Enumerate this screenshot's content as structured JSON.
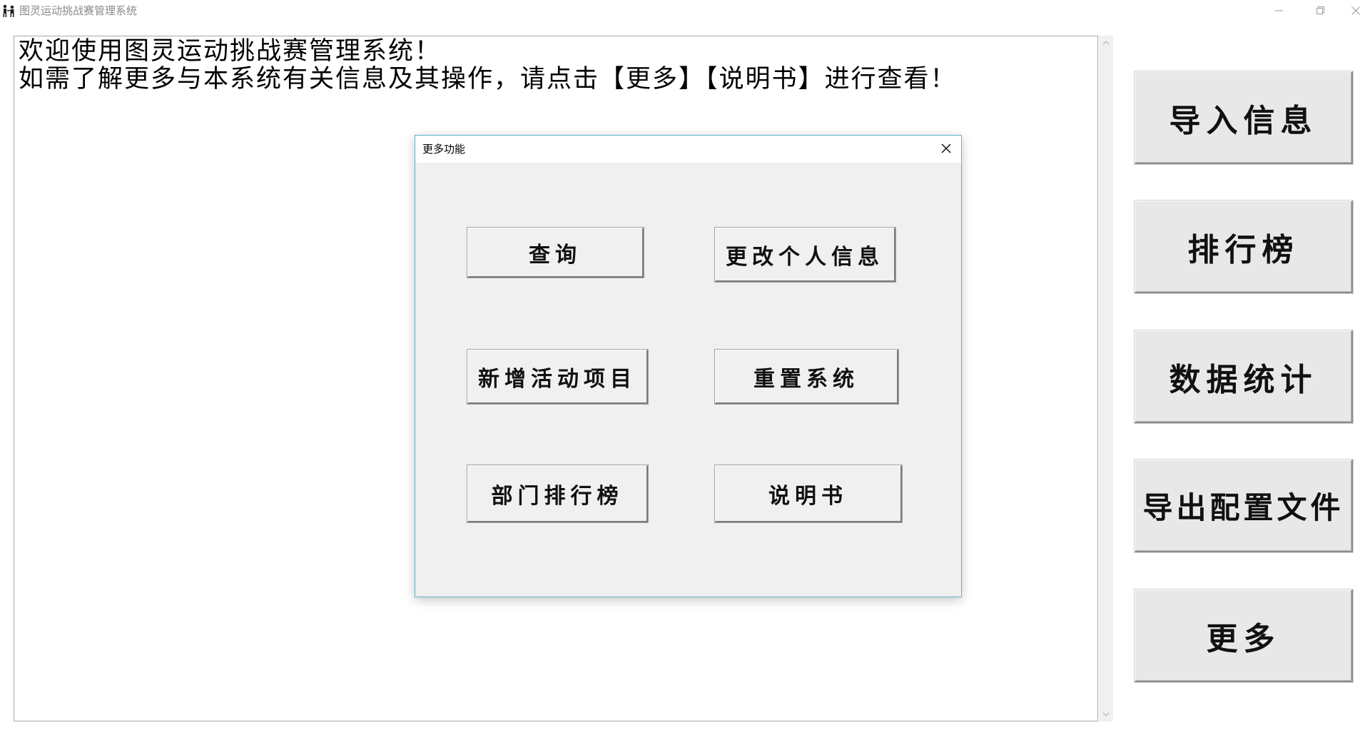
{
  "window": {
    "title": "图灵运动挑战赛管理系统",
    "icon": "people-app-icon",
    "controls": [
      "minimize-icon",
      "restore-icon",
      "close-icon"
    ]
  },
  "main": {
    "welcome_line1": "欢迎使用图灵运动挑战赛管理系统！",
    "welcome_line2": "如需了解更多与本系统有关信息及其操作，请点击【更多】【说明书】进行查看！"
  },
  "sidebar": {
    "buttons": [
      {
        "label": "导入信息"
      },
      {
        "label": "排行榜"
      },
      {
        "label": "数据统计"
      },
      {
        "label": "导出配置文件"
      },
      {
        "label": "更多"
      }
    ]
  },
  "dialog": {
    "title": "更多功能",
    "buttons": [
      {
        "label": "查询"
      },
      {
        "label": "更改个人信息"
      },
      {
        "label": "新增活动项目"
      },
      {
        "label": "重置系统"
      },
      {
        "label": "部门排行榜"
      },
      {
        "label": "说明书"
      }
    ]
  },
  "colors": {
    "dialog_border": "#5fb3c7",
    "button_face": "#f0f0f0",
    "title_text": "#8a8a8a"
  }
}
